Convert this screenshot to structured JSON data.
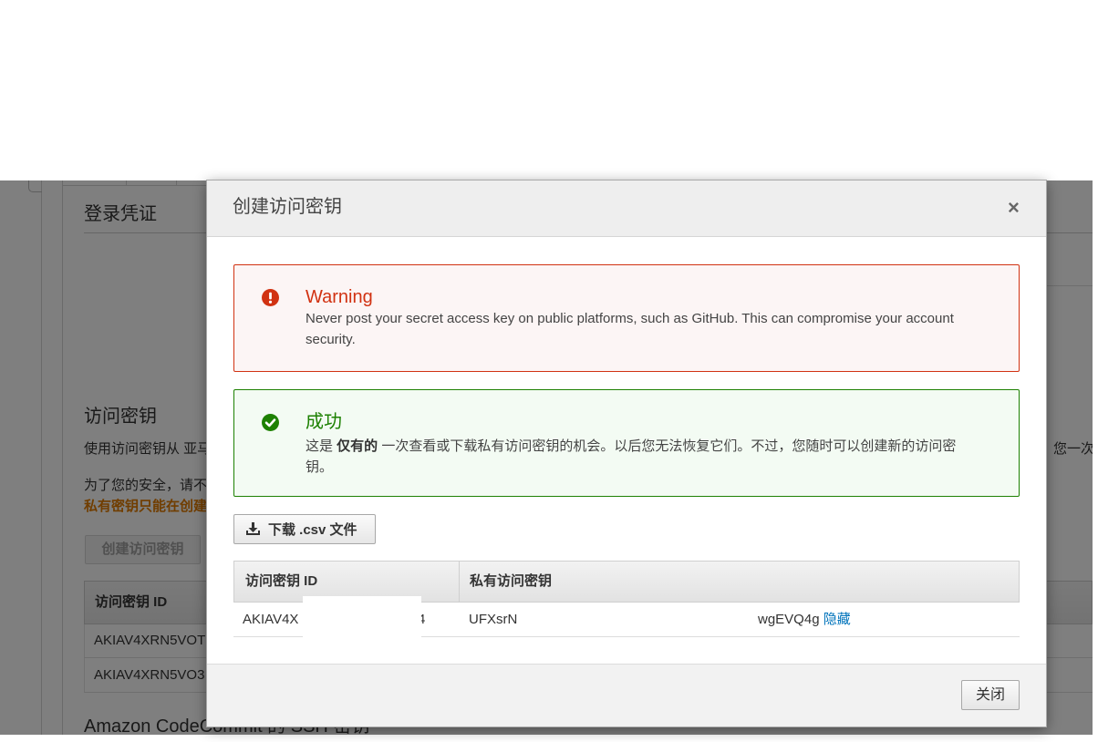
{
  "background_page": {
    "login_credentials_heading": "登录凭证",
    "access_keys_heading": "访问密钥",
    "access_keys_intro": "使用访问密钥从 亚马",
    "access_keys_intro_right": "您一次",
    "security_note": "为了您的安全，请不",
    "private_key_note": "私有密钥只能在创建",
    "create_access_key_button": "创建访问密钥",
    "table": {
      "header_access_key_id": "访问密钥 ID",
      "rows": [
        "AKIAV4XRN5VOT",
        "AKIAV4XRN5VO3"
      ]
    },
    "ssh_keys_heading": "Amazon CodeCommit 的 SSH 密钥"
  },
  "modal": {
    "title": "创建访问密钥",
    "close_symbol": "×",
    "warning": {
      "icon": "exclamation-circle-icon",
      "title": "Warning",
      "message": "Never post your secret access key on public platforms, such as GitHub. This can compromise your account security."
    },
    "success": {
      "icon": "check-circle-icon",
      "title": "成功",
      "message_before": "这是 ",
      "message_emphasis": "仅有的",
      "message_after": " 一次查看或下载私有访问密钥的机会。以后您无法恢复它们。不过，您随时可以创建新的访问密钥。"
    },
    "download_button": {
      "icon": "download-icon",
      "label": "下载 .csv 文件"
    },
    "keys_table": {
      "columns": [
        "访问密钥 ID",
        "私有访问密钥"
      ],
      "row": {
        "access_key_id_start": "AKIAV4X",
        "access_key_id_end": "4",
        "secret_start": "UFXsrN",
        "secret_end": "wgEVQ4g",
        "hide_link": "隐藏"
      }
    },
    "close_button": "关闭"
  },
  "colors": {
    "warning": "#d13212",
    "success": "#1d8102",
    "link": "#0073bb",
    "private_key_note": "#e07b00"
  }
}
